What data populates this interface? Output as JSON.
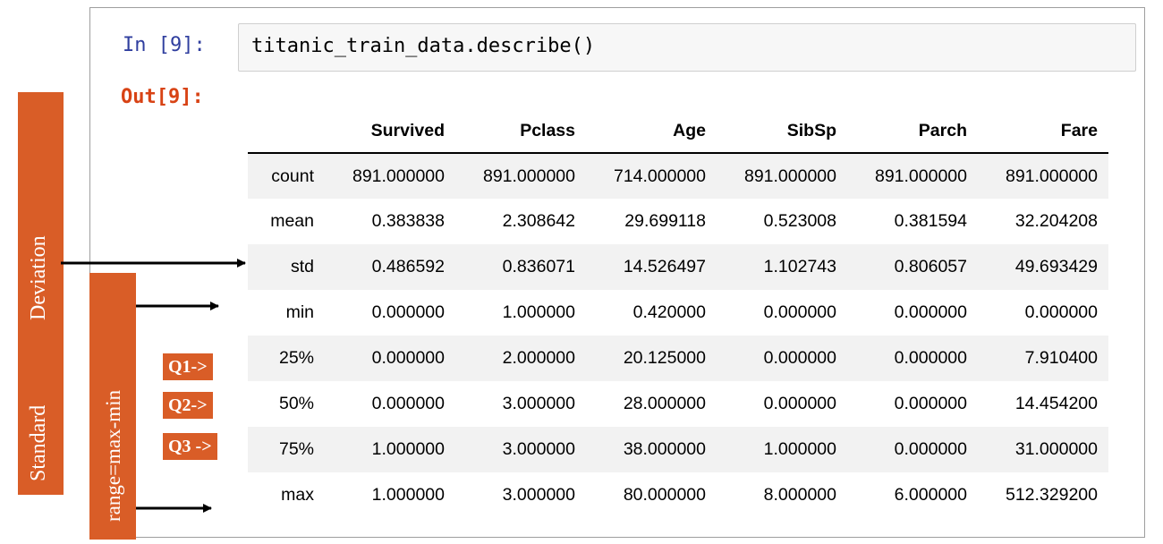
{
  "notebook": {
    "input_prompt": "In [9]:",
    "code": "titanic_train_data.describe()",
    "output_prompt": "Out[9]:"
  },
  "table": {
    "columns": [
      "Survived",
      "Pclass",
      "Age",
      "SibSp",
      "Parch",
      "Fare"
    ],
    "rows": [
      {
        "label": "count",
        "values": [
          "891.000000",
          "891.000000",
          "714.000000",
          "891.000000",
          "891.000000",
          "891.000000"
        ]
      },
      {
        "label": "mean",
        "values": [
          "0.383838",
          "2.308642",
          "29.699118",
          "0.523008",
          "0.381594",
          "32.204208"
        ]
      },
      {
        "label": "std",
        "values": [
          "0.486592",
          "0.836071",
          "14.526497",
          "1.102743",
          "0.806057",
          "49.693429"
        ]
      },
      {
        "label": "min",
        "values": [
          "0.000000",
          "1.000000",
          "0.420000",
          "0.000000",
          "0.000000",
          "0.000000"
        ]
      },
      {
        "label": "25%",
        "values": [
          "0.000000",
          "2.000000",
          "20.125000",
          "0.000000",
          "0.000000",
          "7.910400"
        ]
      },
      {
        "label": "50%",
        "values": [
          "0.000000",
          "3.000000",
          "28.000000",
          "0.000000",
          "0.000000",
          "14.454200"
        ]
      },
      {
        "label": "75%",
        "values": [
          "1.000000",
          "3.000000",
          "38.000000",
          "1.000000",
          "0.000000",
          "31.000000"
        ]
      },
      {
        "label": "max",
        "values": [
          "1.000000",
          "3.000000",
          "80.000000",
          "8.000000",
          "6.000000",
          "512.329200"
        ]
      }
    ]
  },
  "annotations": {
    "std_line1": "Standard",
    "std_line2": "Deviation",
    "range": "range=max-min",
    "q1": "Q1->",
    "q2": "Q2->",
    "q3": "Q3 ->"
  },
  "colors": {
    "annotation_bg": "#d95d27",
    "out_prompt": "#d84315",
    "in_prompt": "#303f9f"
  }
}
